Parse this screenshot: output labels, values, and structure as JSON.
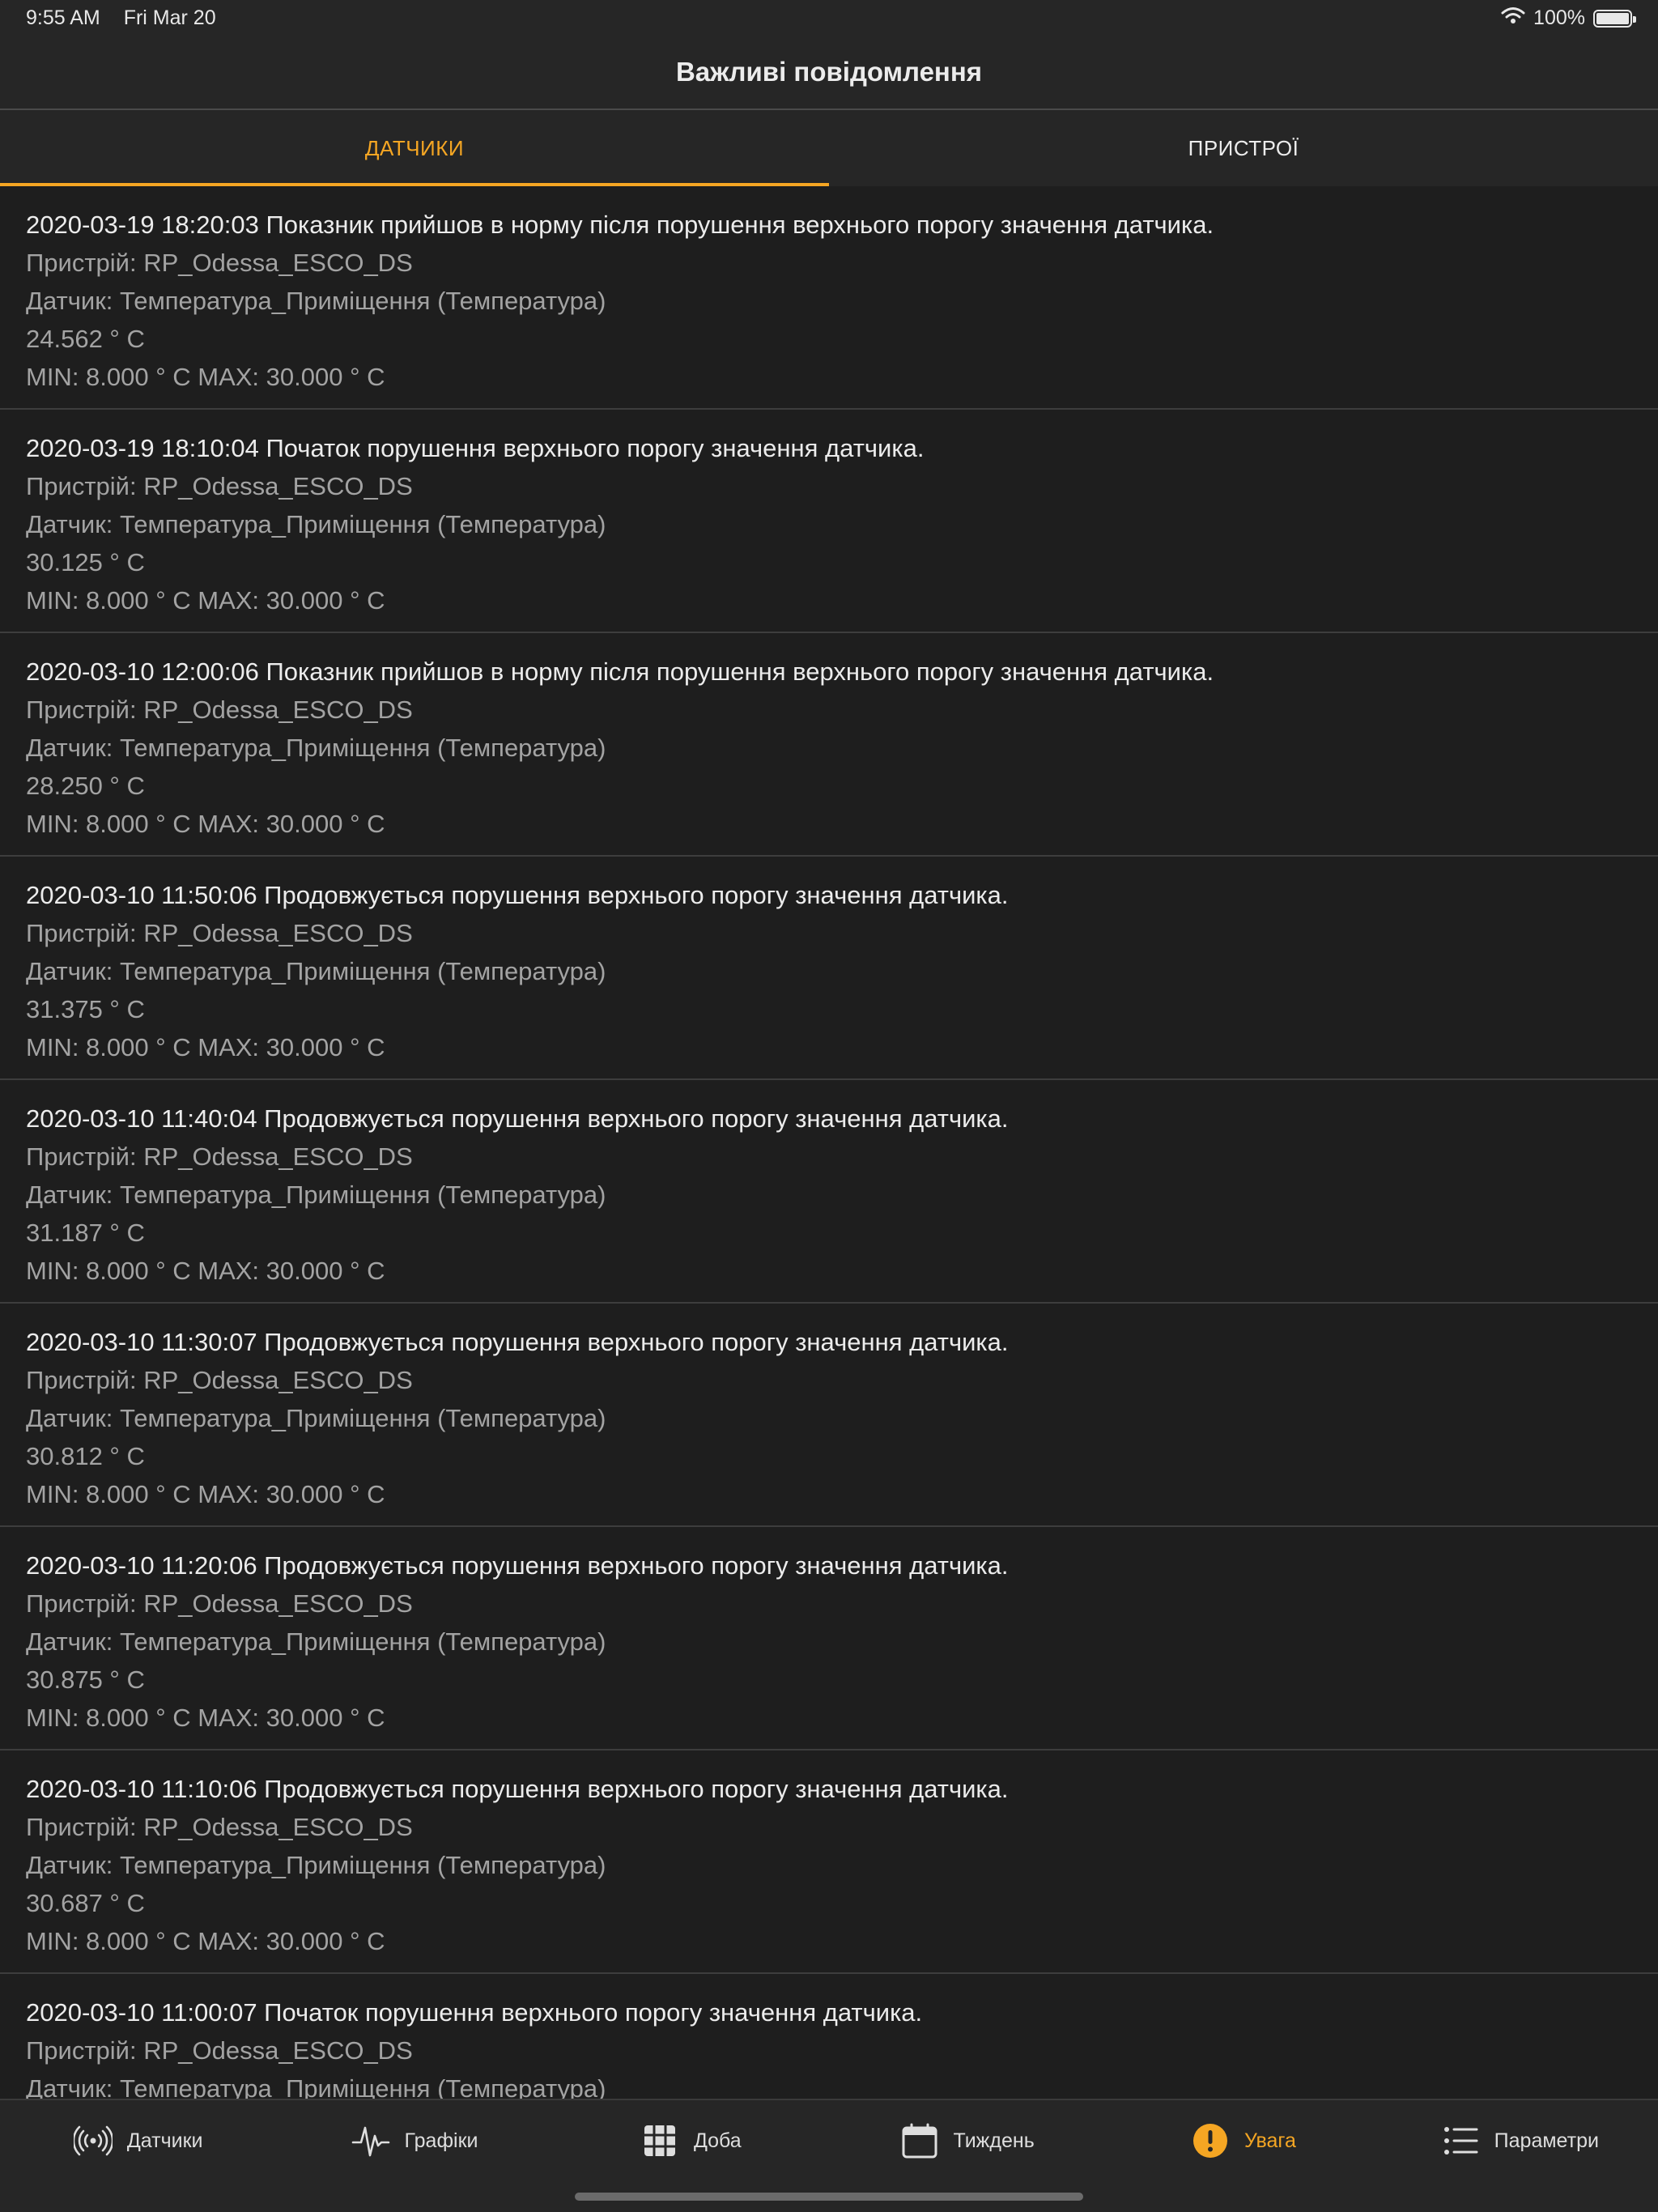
{
  "status_bar": {
    "time": "9:55 AM",
    "date": "Fri Mar 20",
    "battery_percent": "100%"
  },
  "nav": {
    "title": "Важливі повідомлення"
  },
  "tabs": [
    {
      "label": "ДАТЧИКИ",
      "active": true
    },
    {
      "label": "ПРИСТРОЇ",
      "active": false
    }
  ],
  "notifications": [
    {
      "header": "2020-03-19 18:20:03 Показник прийшов в норму після порушення верхнього порогу значення датчика.",
      "device": "Пристрій: RP_Odessa_ESCO_DS",
      "sensor": "Датчик: Температура_Приміщення (Температура)",
      "value": "24.562 ° C",
      "limits": "MIN: 8.000 ° C MAX: 30.000 ° C"
    },
    {
      "header": "2020-03-19 18:10:04 Початок порушення верхнього порогу значення датчика.",
      "device": "Пристрій: RP_Odessa_ESCO_DS",
      "sensor": "Датчик: Температура_Приміщення (Температура)",
      "value": "30.125 ° C",
      "limits": "MIN: 8.000 ° C MAX: 30.000 ° C"
    },
    {
      "header": "2020-03-10 12:00:06 Показник прийшов в норму після порушення верхнього порогу значення датчика.",
      "device": "Пристрій: RP_Odessa_ESCO_DS",
      "sensor": "Датчик: Температура_Приміщення (Температура)",
      "value": "28.250 ° C",
      "limits": "MIN: 8.000 ° C MAX: 30.000 ° C"
    },
    {
      "header": "2020-03-10 11:50:06 Продовжується порушення верхнього порогу значення датчика.",
      "device": "Пристрій: RP_Odessa_ESCO_DS",
      "sensor": "Датчик: Температура_Приміщення (Температура)",
      "value": "31.375 ° C",
      "limits": "MIN: 8.000 ° C MAX: 30.000 ° C"
    },
    {
      "header": "2020-03-10 11:40:04 Продовжується порушення верхнього порогу значення датчика.",
      "device": "Пристрій: RP_Odessa_ESCO_DS",
      "sensor": "Датчик: Температура_Приміщення (Температура)",
      "value": "31.187 ° C",
      "limits": "MIN: 8.000 ° C MAX: 30.000 ° C"
    },
    {
      "header": "2020-03-10 11:30:07 Продовжується порушення верхнього порогу значення датчика.",
      "device": "Пристрій: RP_Odessa_ESCO_DS",
      "sensor": "Датчик: Температура_Приміщення (Температура)",
      "value": "30.812 ° C",
      "limits": "MIN: 8.000 ° C MAX: 30.000 ° C"
    },
    {
      "header": "2020-03-10 11:20:06 Продовжується порушення верхнього порогу значення датчика.",
      "device": "Пристрій: RP_Odessa_ESCO_DS",
      "sensor": "Датчик: Температура_Приміщення (Температура)",
      "value": "30.875 ° C",
      "limits": "MIN: 8.000 ° C MAX: 30.000 ° C"
    },
    {
      "header": "2020-03-10 11:10:06 Продовжується порушення верхнього порогу значення датчика.",
      "device": "Пристрій: RP_Odessa_ESCO_DS",
      "sensor": "Датчик: Температура_Приміщення (Температура)",
      "value": "30.687 ° C",
      "limits": "MIN: 8.000 ° C MAX: 30.000 ° C"
    },
    {
      "header": "2020-03-10 11:00:07 Початок порушення верхнього порогу значення датчика.",
      "device": "Пристрій: RP_Odessa_ESCO_DS",
      "sensor": "Датчик: Температура_Приміщення (Температура)"
    }
  ],
  "tab_bar": [
    {
      "label": "Датчики",
      "icon": "antenna-icon"
    },
    {
      "label": "Графіки",
      "icon": "pulse-icon"
    },
    {
      "label": "Доба",
      "icon": "grid-icon"
    },
    {
      "label": "Тиждень",
      "icon": "calendar-icon"
    },
    {
      "label": "Увага",
      "icon": "alert-icon",
      "active": true
    },
    {
      "label": "Параметри",
      "icon": "list-icon"
    }
  ],
  "colors": {
    "accent": "#f5a623",
    "background": "#1e1e1e",
    "bar": "#262626",
    "separator": "#3d3d3d",
    "secondary_text": "#a3a3a3"
  }
}
